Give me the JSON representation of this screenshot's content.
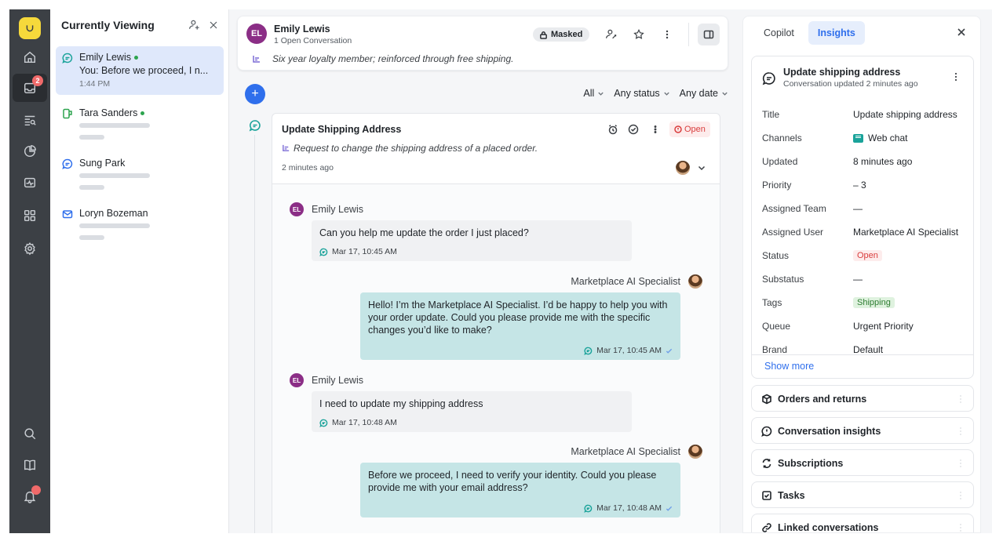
{
  "rail": {
    "notification_count": "2"
  },
  "currently_viewing": {
    "title": "Currently Viewing",
    "items": [
      {
        "name": "Emily Lewis",
        "preview": "You: Before we proceed, I n...",
        "time": "1:44 PM",
        "channel": "chat"
      },
      {
        "name": "Tara Sanders",
        "channel": "sms"
      },
      {
        "name": "Sung Park",
        "channel": "chat"
      },
      {
        "name": "Loryn Bozeman",
        "channel": "email"
      }
    ]
  },
  "customer": {
    "initials": "EL",
    "name": "Emily Lewis",
    "open_conversations": "1 Open Conversation",
    "masked_label": "Masked",
    "summary": "Six year loyalty member; reinforced through free shipping."
  },
  "filters": {
    "type": "All",
    "status": "Any status",
    "date": "Any date"
  },
  "conversation": {
    "title": "Update Shipping Address",
    "description": "Request to change the shipping address of a placed order.",
    "time": "2 minutes ago",
    "status": "Open",
    "messages": [
      {
        "direction": "in",
        "sender": "Emily Lewis",
        "text": "Can you help me update the order I just placed?",
        "time": "Mar 17, 10:45 AM"
      },
      {
        "direction": "out",
        "sender": "Marketplace AI Specialist",
        "text": "Hello! I’m the Marketplace AI Specialist. I’d be happy to help you with your order update. Could you please provide me with the specific changes you’d like to make?",
        "time": "Mar 17, 10:45 AM"
      },
      {
        "direction": "in",
        "sender": "Emily Lewis",
        "text": "I need to update my shipping address",
        "time": "Mar 17, 10:48 AM"
      },
      {
        "direction": "out",
        "sender": "Marketplace AI Specialist",
        "text": "Before we proceed, I need to verify your identity. Could you please provide me with your email address?",
        "time": "Mar 17, 10:48 AM"
      }
    ]
  },
  "right_panel": {
    "tabs": [
      "Copilot",
      "Insights"
    ],
    "active_tab": "Insights",
    "details": {
      "title": "Update shipping address",
      "subtitle": "Conversation updated 2 minutes ago",
      "rows": [
        {
          "label": "Title",
          "value": "Update shipping address"
        },
        {
          "label": "Channels",
          "value": "Web chat"
        },
        {
          "label": "Updated",
          "value": "8 minutes ago"
        },
        {
          "label": "Priority",
          "value": "– 3"
        },
        {
          "label": "Assigned Team",
          "value": "—"
        },
        {
          "label": "Assigned User",
          "value": "Marketplace AI Specialist"
        },
        {
          "label": "Status",
          "value": "Open"
        },
        {
          "label": "Substatus",
          "value": "—"
        },
        {
          "label": "Tags",
          "value": "Shipping"
        },
        {
          "label": "Queue",
          "value": "Urgent Priority"
        },
        {
          "label": "Brand",
          "value": "Default"
        }
      ],
      "show_more": "Show more"
    },
    "sections": [
      "Orders and returns",
      "Conversation insights",
      "Subscriptions",
      "Tasks",
      "Linked conversations"
    ]
  },
  "colors": {
    "accent": "#2f6fec",
    "rail": "#3c4045",
    "customer_avatar": "#8b2e86",
    "outgoing_bubble": "#c5e5e6",
    "open_status": "#d93d3d",
    "tag_green": "#2e7d32"
  }
}
